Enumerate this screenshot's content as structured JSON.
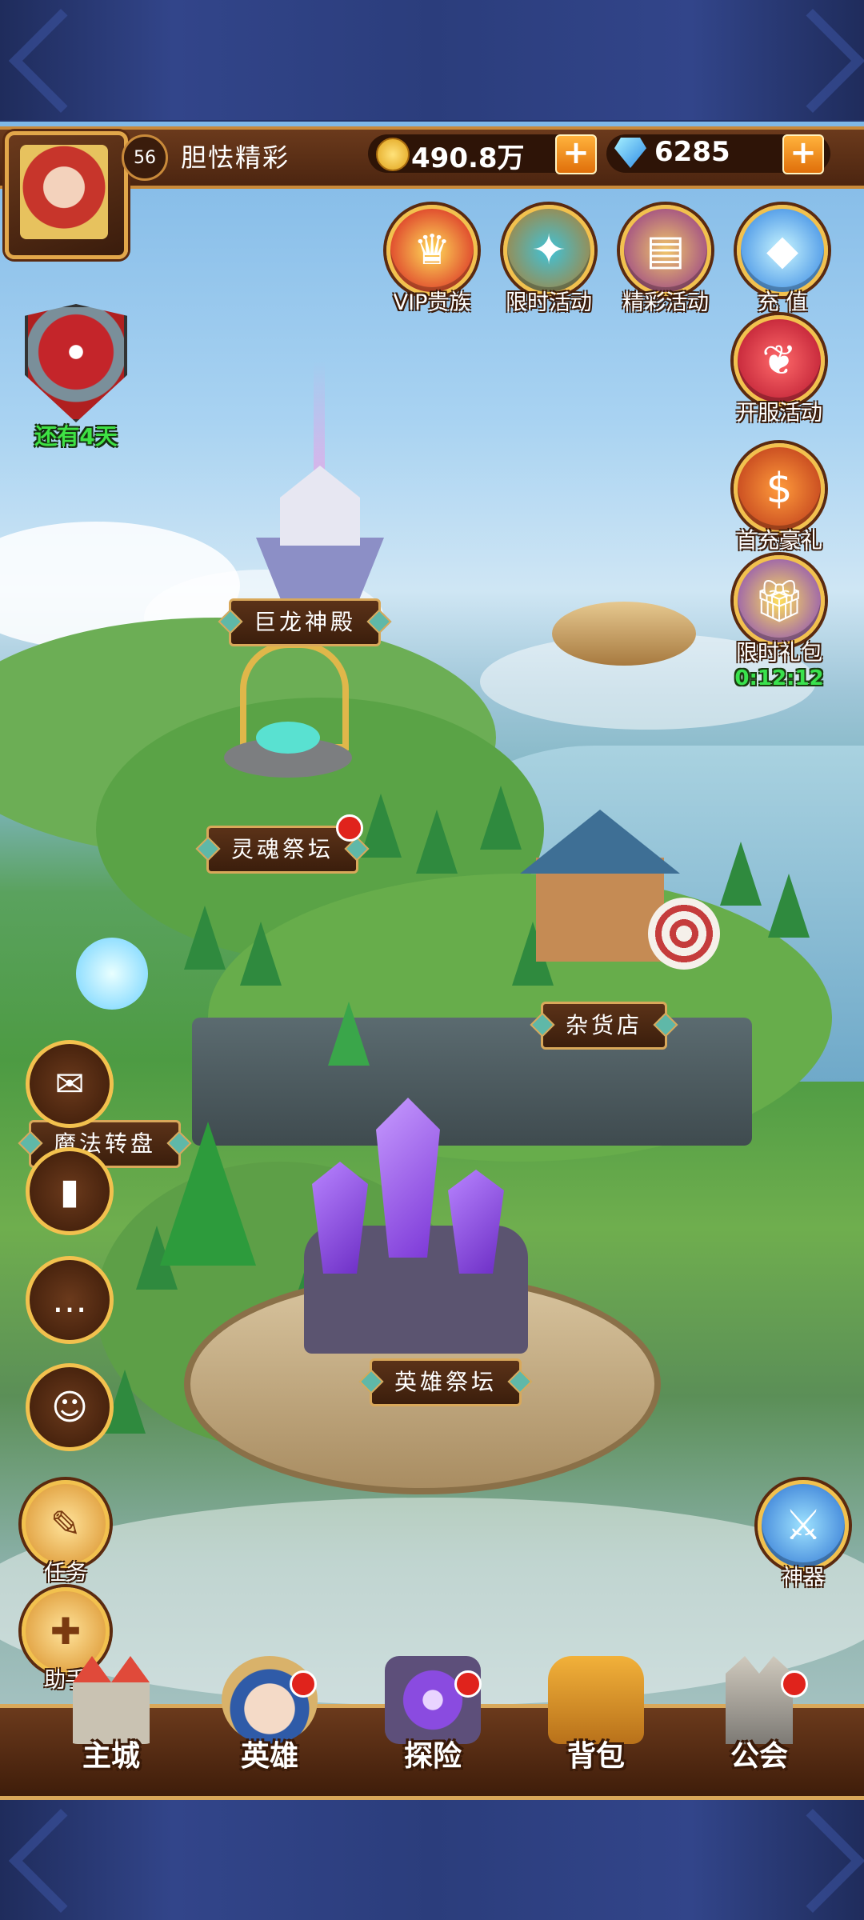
{
  "player": {
    "level": "56",
    "name": "胆怯精彩"
  },
  "resources": {
    "gold": "490.8万",
    "diamonds": "6285",
    "plus_symbol": "+"
  },
  "top_icons": [
    {
      "label": "VIP贵族",
      "icon": "crown-icon"
    },
    {
      "label": "限时活动",
      "icon": "compass-icon"
    },
    {
      "label": "精彩活动",
      "icon": "scroll-icon"
    },
    {
      "label": "充 值",
      "icon": "diamond-icon"
    }
  ],
  "right_icons": [
    {
      "label": "开服活动",
      "icon": "feather-icon"
    },
    {
      "label": "首充豪礼",
      "icon": "treasure-bag-icon"
    },
    {
      "label": "限时礼包",
      "icon": "gift-box-icon",
      "timer": "0:12:12"
    },
    {
      "label": "神器",
      "icon": "artifact-icon"
    }
  ],
  "event": {
    "text": "还有4天"
  },
  "buildings": {
    "dragon_temple": "巨龙神殿",
    "soul_altar": "灵魂祭坛",
    "shop": "杂货店",
    "magic_wheel": "魔法转盘",
    "hero_altar": "英雄祭坛"
  },
  "left_buttons": [
    {
      "name": "mail",
      "icon": "envelope-icon",
      "glyph": "✉"
    },
    {
      "name": "rank",
      "icon": "ranking-icon",
      "glyph": "▮"
    },
    {
      "name": "chat",
      "icon": "chat-icon",
      "glyph": "…"
    },
    {
      "name": "friends",
      "icon": "contacts-icon",
      "glyph": "☺"
    }
  ],
  "left_tasks": [
    {
      "label": "任务",
      "icon": "quest-scroll-icon",
      "glyph": "✎"
    },
    {
      "label": "助手",
      "icon": "helper-gift-icon",
      "glyph": "✚"
    }
  ],
  "bottom_nav": [
    {
      "label": "主城",
      "icon": "castle-icon"
    },
    {
      "label": "英雄",
      "icon": "hero-icon"
    },
    {
      "label": "探险",
      "icon": "portal-icon"
    },
    {
      "label": "背包",
      "icon": "backpack-icon"
    },
    {
      "label": "公会",
      "icon": "guild-icon"
    }
  ],
  "colors": {
    "accent_gold": "#f2c14e",
    "wood_dark": "#3b1e0c",
    "notice_red": "#e0231c",
    "timer_green": "#39e24d"
  }
}
